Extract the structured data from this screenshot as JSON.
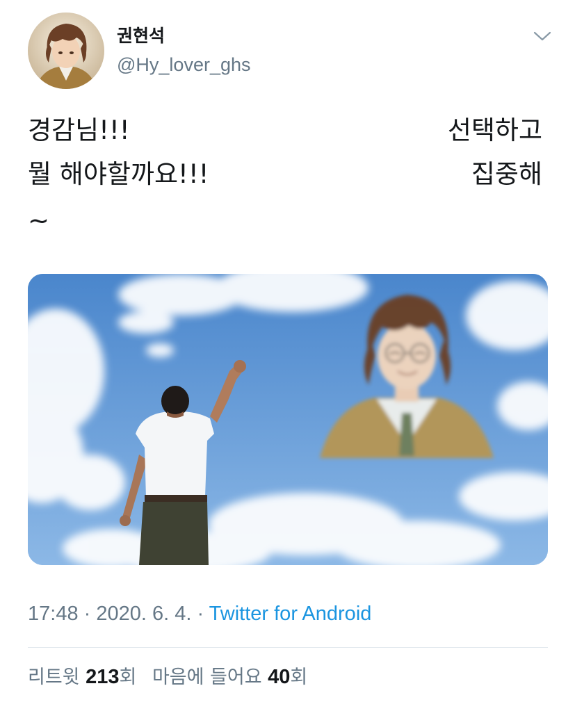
{
  "user": {
    "name": "권현석",
    "handle": "@Hy_lover_ghs"
  },
  "tweet": {
    "left_lines": [
      "경감님!!!",
      "뭘 해야할까요!!!",
      "~"
    ],
    "right_lines": [
      "선택하고",
      "집중해"
    ]
  },
  "meta": {
    "time": "17:48",
    "sep1": " · ",
    "date": "2020. 6. 4.",
    "sep2": " · ",
    "source": "Twitter for Android"
  },
  "stats": {
    "retweets_label": "리트윗 ",
    "retweets_count": "213",
    "retweets_suffix": "회",
    "likes_label": "마음에 들어요 ",
    "likes_count": "40",
    "likes_suffix": "회"
  },
  "colors": {
    "link": "#1b95e0",
    "secondary_text": "#657786",
    "primary_text": "#14171a",
    "divider": "#e1e8ed"
  },
  "icons": {
    "more": "chevron-down-icon"
  }
}
